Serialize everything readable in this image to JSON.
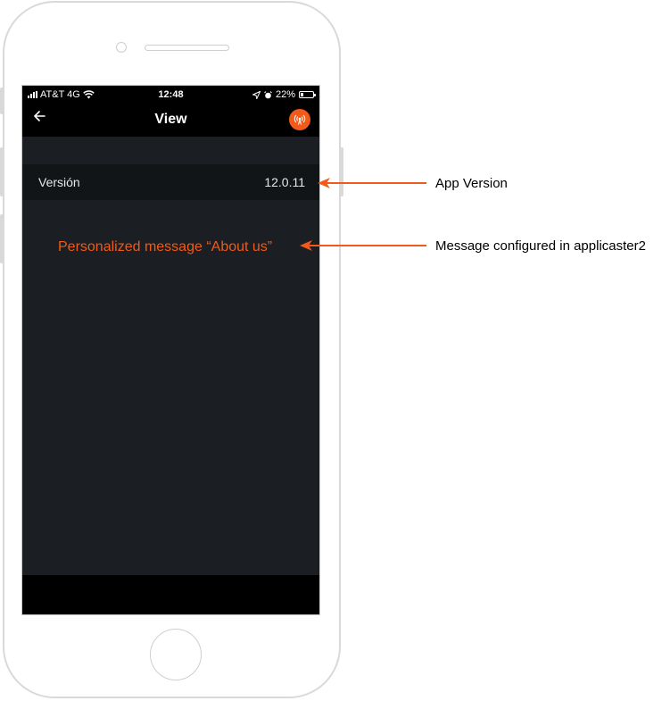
{
  "status_bar": {
    "carrier": "AT&T 4G",
    "time": "12:48",
    "battery_percent": "22%",
    "battery_level": 0.22
  },
  "nav_bar": {
    "back_icon": "arrow-left-icon",
    "title": "View",
    "live_icon": "broadcast-icon"
  },
  "content": {
    "version_label": "Versión",
    "version_value": "12.0.11",
    "about_message": "Personalized message “About us”"
  },
  "annotations": {
    "app_version": "App Version",
    "message_configured": "Message configured in applicaster2"
  },
  "colors": {
    "accent": "#f05a1a",
    "screen_background": "#1b1e22",
    "bar_background": "#000000"
  }
}
